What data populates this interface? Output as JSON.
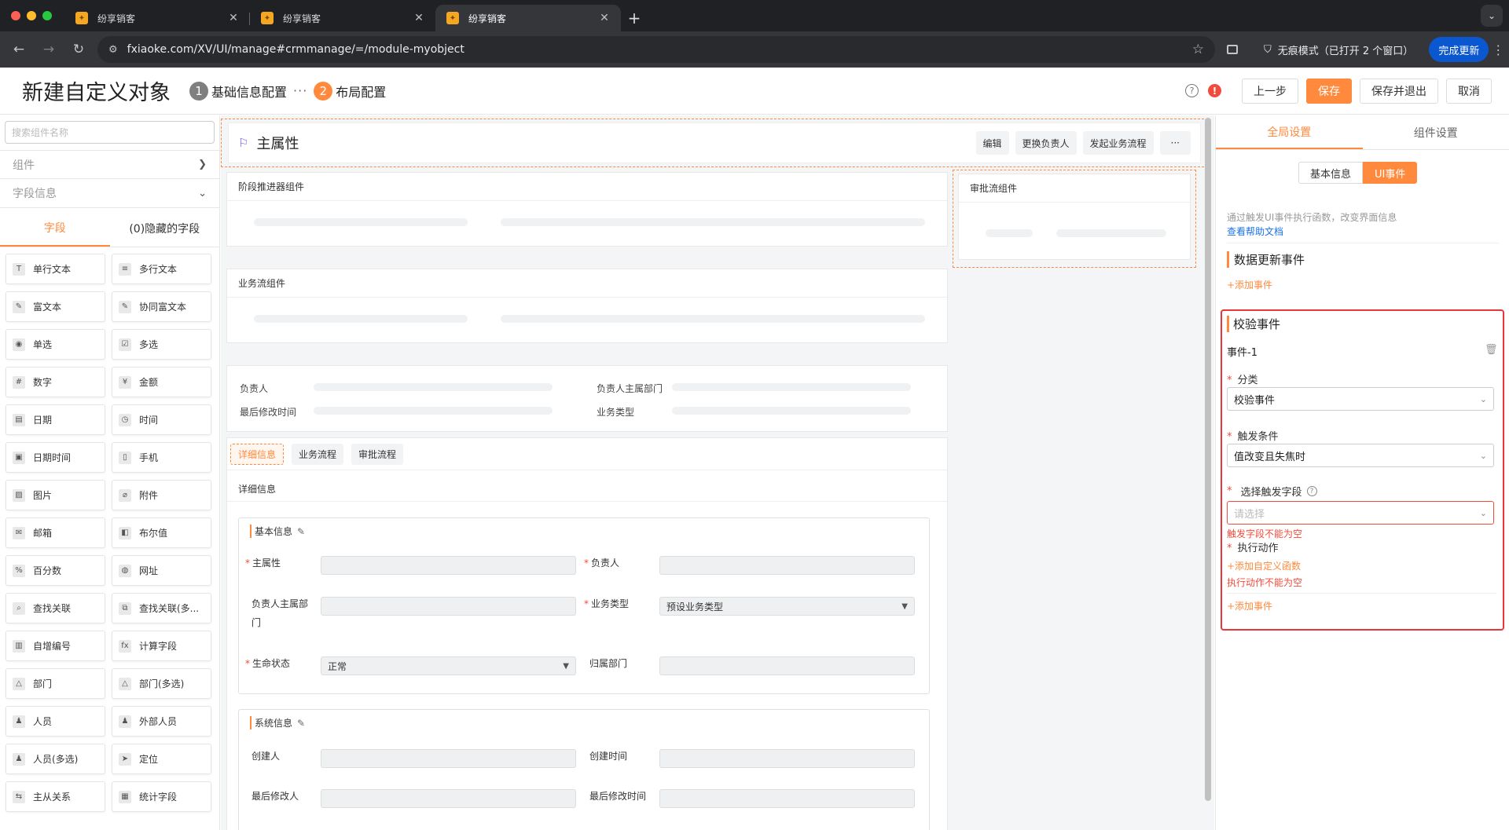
{
  "browser": {
    "tabs": [
      {
        "title": "纷享销客",
        "active": false
      },
      {
        "title": "纷享销客",
        "active": false
      },
      {
        "title": "纷享销客",
        "active": true
      }
    ],
    "url": "fxiaoke.com/XV/UI/manage#crmmanage/=/module-myobject",
    "incognito_label": "无痕模式（已打开 2 个窗口）",
    "update_label": "完成更新"
  },
  "header": {
    "title": "新建自定义对象",
    "steps": [
      {
        "num": "1",
        "label": "基础信息配置"
      },
      {
        "num": "2",
        "label": "布局配置"
      }
    ],
    "dots": "···",
    "help_icon": "?",
    "alert_icon": "!",
    "buttons": {
      "prev": "上一步",
      "save": "保存",
      "save_exit": "保存并退出",
      "cancel": "取消"
    }
  },
  "left_panel": {
    "search_placeholder": "搜索组件名称",
    "sections": [
      "组件",
      "字段信息"
    ],
    "tabs": [
      "字段",
      "(0)隐藏的字段"
    ],
    "fields": [
      {
        "label": "单行文本",
        "icon": "text-icon",
        "glyph": "T"
      },
      {
        "label": "多行文本",
        "icon": "multiline-icon",
        "glyph": "≡"
      },
      {
        "label": "富文本",
        "icon": "richtext-icon",
        "glyph": "✎"
      },
      {
        "label": "协同富文本",
        "icon": "collab-richtext-icon",
        "glyph": "✎"
      },
      {
        "label": "单选",
        "icon": "radio-icon",
        "glyph": "◉"
      },
      {
        "label": "多选",
        "icon": "checkbox-icon",
        "glyph": "☑"
      },
      {
        "label": "数字",
        "icon": "number-icon",
        "glyph": "#"
      },
      {
        "label": "金额",
        "icon": "currency-icon",
        "glyph": "¥"
      },
      {
        "label": "日期",
        "icon": "date-icon",
        "glyph": "▤"
      },
      {
        "label": "时间",
        "icon": "clock-icon",
        "glyph": "◷"
      },
      {
        "label": "日期时间",
        "icon": "datetime-icon",
        "glyph": "▣"
      },
      {
        "label": "手机",
        "icon": "phone-icon",
        "glyph": "▯"
      },
      {
        "label": "图片",
        "icon": "image-icon",
        "glyph": "▨"
      },
      {
        "label": "附件",
        "icon": "attachment-icon",
        "glyph": "⌀"
      },
      {
        "label": "邮箱",
        "icon": "email-icon",
        "glyph": "✉"
      },
      {
        "label": "布尔值",
        "icon": "boolean-icon",
        "glyph": "◧"
      },
      {
        "label": "百分数",
        "icon": "percent-icon",
        "glyph": "%"
      },
      {
        "label": "网址",
        "icon": "globe-icon",
        "glyph": "◍"
      },
      {
        "label": "查找关联",
        "icon": "lookup-icon",
        "glyph": "⌕"
      },
      {
        "label": "查找关联(多...",
        "icon": "lookup-multi-icon",
        "glyph": "⧉"
      },
      {
        "label": "自增编号",
        "icon": "autonumber-icon",
        "glyph": "▥"
      },
      {
        "label": "计算字段",
        "icon": "formula-icon",
        "glyph": "fx"
      },
      {
        "label": "部门",
        "icon": "department-icon",
        "glyph": "△"
      },
      {
        "label": "部门(多选)",
        "icon": "department-multi-icon",
        "glyph": "△"
      },
      {
        "label": "人员",
        "icon": "person-icon",
        "glyph": "♟"
      },
      {
        "label": "外部人员",
        "icon": "external-person-icon",
        "glyph": "♟"
      },
      {
        "label": "人员(多选)",
        "icon": "person-multi-icon",
        "glyph": "♟"
      },
      {
        "label": "定位",
        "icon": "location-icon",
        "glyph": "➤"
      },
      {
        "label": "主从关系",
        "icon": "master-detail-icon",
        "glyph": "⇆"
      },
      {
        "label": "统计字段",
        "icon": "statistics-icon",
        "glyph": "▦"
      }
    ]
  },
  "canvas": {
    "main_title": "主属性",
    "top_buttons": [
      "编辑",
      "更换负责人",
      "发起业务流程",
      "···"
    ],
    "stage_card": "阶段推进器组件",
    "flow_card": "业务流组件",
    "approval_card": "审批流组件",
    "summary": {
      "owner": "负责人",
      "owner_dept": "负责人主属部门",
      "modified_time": "最后修改时间",
      "biz_type": "业务类型"
    },
    "detail_tabs": [
      "详细信息",
      "业务流程",
      "审批流程"
    ],
    "detail_title": "详细信息",
    "basic": {
      "title": "基本信息",
      "name": "主属性",
      "owner": "负责人",
      "owner_dept_a": "负责人主属部",
      "owner_dept_b": "门",
      "biz_type": "业务类型",
      "biz_type_value": "预设业务类型",
      "life_status": "生命状态",
      "life_status_value": "正常",
      "belong_dept": "归属部门"
    },
    "system": {
      "title": "系统信息",
      "creator": "创建人",
      "create_time": "创建时间",
      "modifier": "最后修改人",
      "modified_time": "最后修改时间"
    }
  },
  "right_panel": {
    "tabs": [
      "全局设置",
      "组件设置"
    ],
    "seg": [
      "基本信息",
      "UI事件"
    ],
    "desc": "通过触发UI事件执行函数，改变界面信息",
    "help_link": "查看帮助文档",
    "data_update_title": "数据更新事件",
    "add_event": "+添加事件",
    "validate_title": "校验事件",
    "event_name": "事件-1",
    "category_label": "分类",
    "category_value": "校验事件",
    "trigger_label": "触发条件",
    "trigger_value": "值改变且失焦时",
    "field_label": "选择触发字段",
    "field_placeholder": "请选择",
    "field_error": "触发字段不能为空",
    "action_label": "执行动作",
    "add_function": "+添加自定义函数",
    "action_error": "执行动作不能为空",
    "add_event2": "+添加事件"
  },
  "colors": {
    "accent": "#ff8a3d",
    "error": "#f04b3c",
    "highlight_box": "#e8363a",
    "chrome_update": "#0b57d0"
  }
}
